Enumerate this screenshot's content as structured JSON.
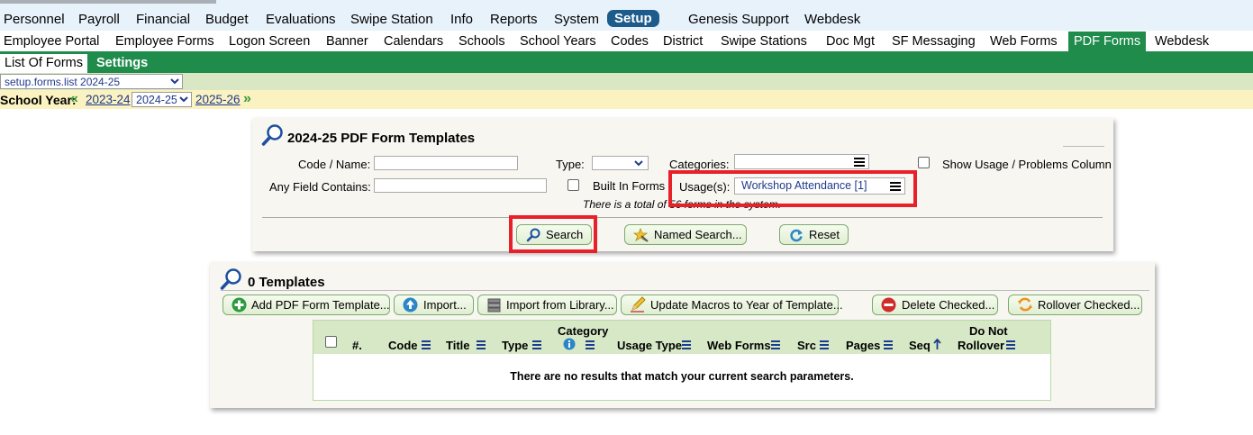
{
  "top_nav": {
    "items": [
      "Personnel",
      "Payroll",
      "Financial",
      "Budget",
      "Evaluations",
      "Swipe Station",
      "Info",
      "Reports",
      "System",
      "Setup",
      "Genesis Support",
      "Webdesk"
    ],
    "active": "Setup"
  },
  "sub_nav": {
    "items": [
      "Employee Portal",
      "Employee Forms",
      "Logon Screen",
      "Banner",
      "Calendars",
      "Schools",
      "School Years",
      "Codes",
      "District",
      "Swipe Stations",
      "Doc Mgt",
      "SF Messaging",
      "Web Forms",
      "PDF Forms",
      "Webdesk"
    ],
    "active": "PDF Forms"
  },
  "tabs": {
    "active": "List Of Forms",
    "other": "Settings"
  },
  "view_select": {
    "value": "setup.forms.list 2024-25"
  },
  "school_year": {
    "label": "School Year:",
    "prev": "2023-24",
    "current": "2024-25",
    "next": "2025-26"
  },
  "search_panel": {
    "title": "2024-25 PDF Form Templates",
    "code_name_label": "Code / Name:",
    "type_label": "Type:",
    "categories_label": "Categories:",
    "show_usage_label": "Show Usage / Problems Column",
    "any_field_label": "Any Field Contains:",
    "built_in_label": "Built In Forms",
    "usages_label": "Usage(s):",
    "usages_value": "Workshop Attendance [1]",
    "total_text": "There is a total of 56 forms in the system.",
    "search_button": "Search",
    "named_search_button": "Named Search...",
    "reset_button": "Reset"
  },
  "results_panel": {
    "title": "0 Templates",
    "buttons": {
      "add": "Add PDF Form Template...",
      "import": "Import...",
      "import_library": "Import from Library...",
      "update_macros": "Update Macros to Year of Template...",
      "delete": "Delete Checked...",
      "rollover": "Rollover Checked..."
    },
    "columns": {
      "num": "#.",
      "code": "Code",
      "title": "Title",
      "type": "Type",
      "category": "Category",
      "usage_type": "Usage Type",
      "web_forms": "Web Forms",
      "src": "Src",
      "pages": "Pages",
      "seq": "Seq",
      "do_not": "Do Not",
      "rollover": "Rollover"
    },
    "empty_message": "There are no results that match your current search parameters."
  },
  "colors": {
    "nav_bg": "#e8f2fb",
    "setup_active": "#1d5b8a",
    "green_bar": "#1f8c4c",
    "select_row": "#d9e7c5",
    "year_row": "#fbf2c2",
    "highlight_red": "#e8202a",
    "link_blue": "#203a8a"
  }
}
